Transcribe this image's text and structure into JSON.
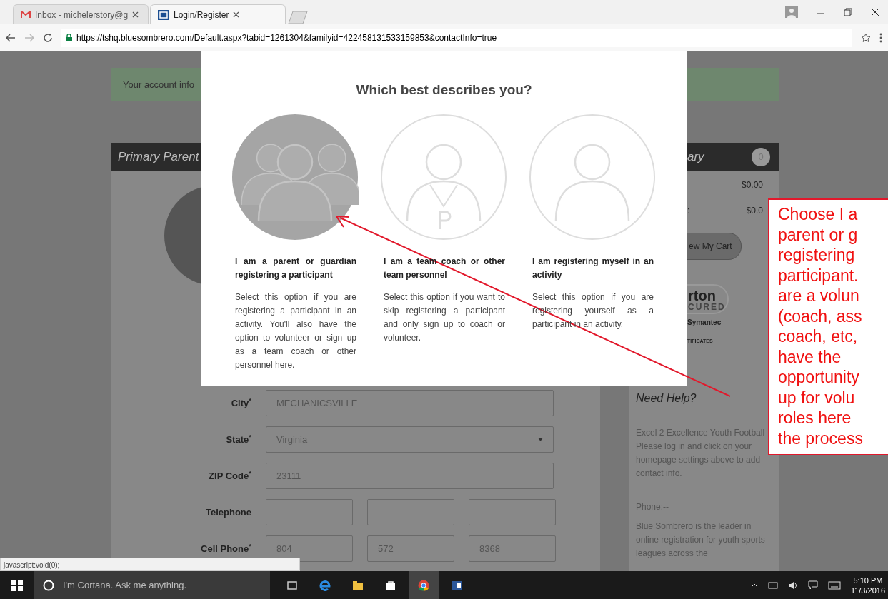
{
  "browser": {
    "tabs": [
      {
        "title": "Inbox - michelerstory@g",
        "selected": false
      },
      {
        "title": "Login/Register",
        "selected": true
      }
    ],
    "url": "https://tshq.bluesombrero.com/Default.aspx?tabid=1261304&familyid=422458131533159853&contactInfo=true",
    "status_text": "javascript:void(0);"
  },
  "page": {
    "notice": "Your account info",
    "primary_panel": {
      "title": "Primary Parent"
    },
    "form": [
      {
        "label": "City$^{*}$",
        "kind": "text",
        "values": [
          "MECHANICSVILLE"
        ]
      },
      {
        "label": "State$^{*}$",
        "kind": "select",
        "values": [
          "Virginia"
        ]
      },
      {
        "label": "ZIP Code$^{*}$",
        "kind": "text",
        "values": [
          "23111"
        ]
      },
      {
        "label": "Telephone",
        "kind": "phone"
      },
      {
        "label": "Cell Phone$^{*}$",
        "kind": "phone",
        "values": [
          "804",
          "572",
          "8368"
        ]
      }
    ],
    "summary": {
      "title": "ary",
      "count": "0",
      "rows": [
        {
          "amount": "$0.00"
        },
        {
          "label": ":",
          "amount": "$0.0"
        }
      ],
      "cart_button": "ew My Cart",
      "seal": [
        "rton",
        "CURED",
        "Symantec",
        "TIFICATES"
      ]
    },
    "help": {
      "title": "Need Help?",
      "org": "Excel 2 Excellence Youth Football",
      "message": "Please log in and click on your homepage settings above to add contact info.",
      "phone": "Phone:--",
      "about": "Blue Sombrero is the leader in online registration for youth sports leagues across the"
    }
  },
  "modal": {
    "title": "Which best describes you?",
    "options": [
      {
        "kind": "group",
        "selected": true,
        "heading": "I am a parent or guardian registering a participant",
        "description": "Select this option if you are registering a participant in an activity. You'll also have the option to volunteer or sign up as a team coach or other personnel here."
      },
      {
        "kind": "coach",
        "selected": false,
        "heading": "I am a team coach or other team personnel",
        "description": "Select this option if you want to skip registering a participant and only sign up to coach or volunteer."
      },
      {
        "kind": "self",
        "selected": false,
        "heading": "I am registering myself in an activity",
        "description": "Select this option if you are registering yourself as a participant in an activity."
      }
    ]
  },
  "annotation": {
    "lines": [
      "Choose I a",
      "parent or g",
      "registering",
      "participant.",
      "are a volun",
      "(coach, ass",
      "coach, etc,",
      "have the",
      "opportunity",
      "up for volu",
      "roles here",
      "the process"
    ]
  },
  "taskbar": {
    "search_placeholder": "I'm Cortana. Ask me anything.",
    "time": "5:10 PM",
    "date": "11/3/2016"
  }
}
